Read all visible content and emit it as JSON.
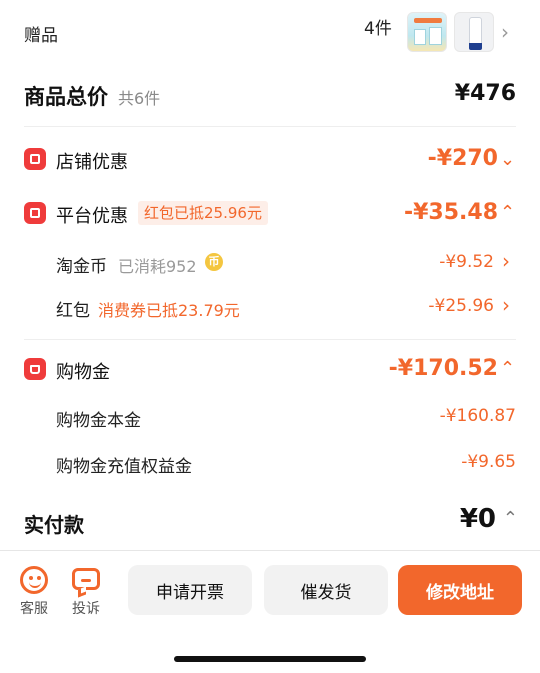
{
  "gift": {
    "label": "赠品",
    "count": "4件"
  },
  "total": {
    "title": "商品总价",
    "sub": "共6件",
    "amount": "¥476"
  },
  "store_discount": {
    "title": "店铺优惠",
    "amount": "-¥270"
  },
  "platform_discount": {
    "title": "平台优惠",
    "tag": "红包已抵25.96元",
    "amount": "-¥35.48",
    "items": [
      {
        "label": "淘金币",
        "note": "已消耗952",
        "coin_glyph": "币",
        "amount": "-¥9.52"
      },
      {
        "label": "红包",
        "note": "消费券已抵23.79元",
        "amount": "-¥25.96"
      }
    ]
  },
  "shopping_gold": {
    "title": "购物金",
    "amount": "-¥170.52",
    "items": [
      {
        "label": "购物金本金",
        "amount": "-¥160.87"
      },
      {
        "label": "购物金充值权益金",
        "amount": "-¥9.65"
      }
    ]
  },
  "paid": {
    "title": "实付款",
    "amount": "¥0"
  },
  "bottom": {
    "service_label": "客服",
    "complaint_label": "投诉",
    "invoice_button": "申请开票",
    "urge_button": "催发货",
    "address_button": "修改地址"
  },
  "colors": {
    "accent": "#f2672c",
    "icon_red": "#ef3b3b"
  },
  "icons": [
    "store-icon",
    "platform-icon",
    "coin-icon",
    "shopping-gold-icon",
    "service-face-icon",
    "complaint-chat-icon",
    "chevron-right-icon",
    "chevron-down-icon",
    "chevron-up-icon"
  ]
}
